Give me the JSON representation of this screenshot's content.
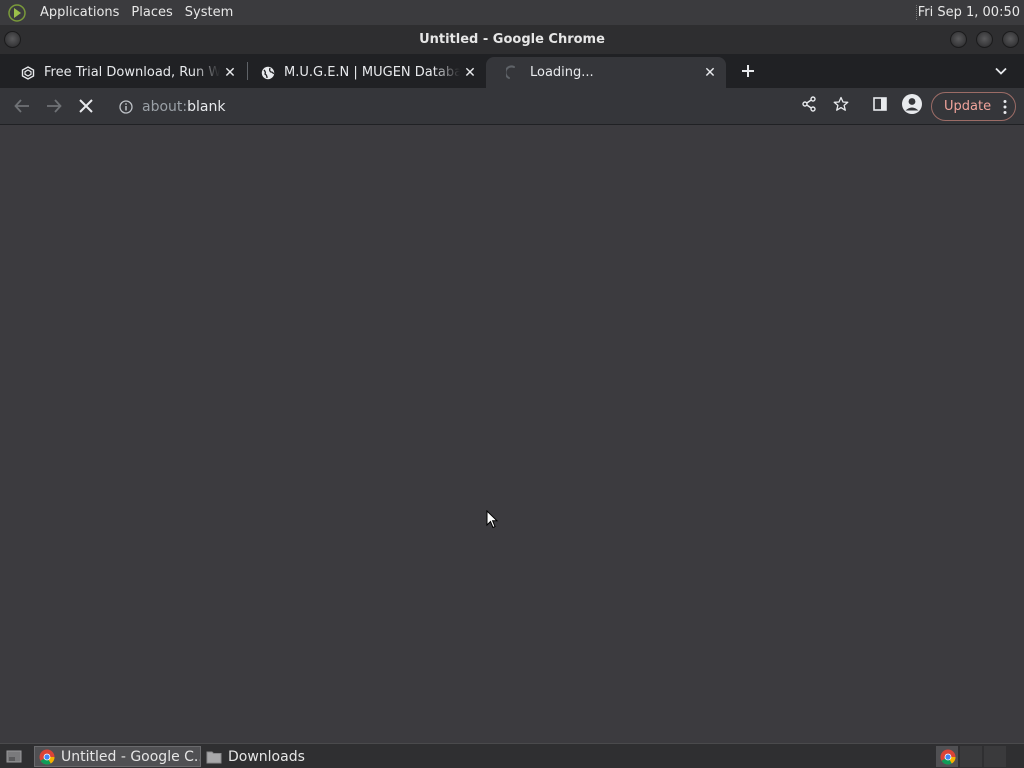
{
  "top_panel": {
    "menus": [
      "Applications",
      "Places",
      "System"
    ],
    "clock": "Fri Sep  1, 00:50"
  },
  "window": {
    "title": "Untitled - Google Chrome"
  },
  "tabs": [
    {
      "title": "Free Trial Download, Run Windows",
      "favicon": "parallels-icon",
      "active": false
    },
    {
      "title": "M.U.G.E.N | MUGEN Database",
      "favicon": "globe-icon",
      "active": false
    },
    {
      "title": "Loading...",
      "favicon": "loading-spinner-icon",
      "active": true
    }
  ],
  "toolbar": {
    "url_scheme": "about:",
    "url_rest": "blank",
    "update_label": "Update"
  },
  "taskbar": {
    "items": [
      {
        "label": "Untitled - Google C...",
        "icon": "chrome-icon",
        "active": true
      },
      {
        "label": "Downloads",
        "icon": "folder-icon",
        "active": false
      }
    ]
  },
  "colors": {
    "page_bg": "#3c3b3f",
    "tabstrip_bg": "#202124",
    "toolbar_bg": "#35363a",
    "update_accent": "#f28b82"
  }
}
